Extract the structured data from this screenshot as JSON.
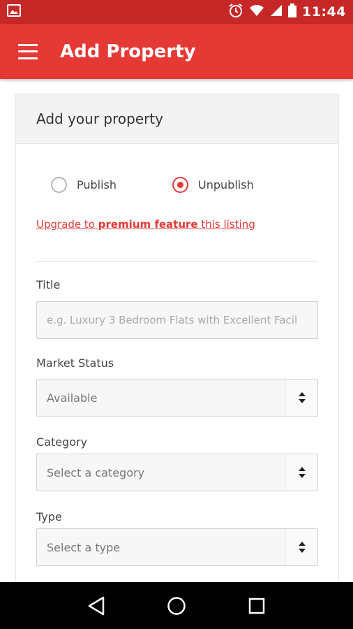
{
  "status_bar": {
    "time": "11:44",
    "icons": [
      "image-icon",
      "alarm-icon",
      "wifi-icon",
      "signal-icon",
      "battery-icon"
    ]
  },
  "app_bar": {
    "title": "Add Property",
    "menu_icon": "menu-icon"
  },
  "colors": {
    "status_bar": "#c62828",
    "app_bar": "#e53935",
    "accent": "#e53935"
  },
  "card": {
    "header": "Add your property",
    "publish_options": [
      {
        "label": "Publish",
        "selected": false
      },
      {
        "label": "Unpublish",
        "selected": true
      }
    ],
    "upgrade_link": {
      "prefix": "Upgrade to ",
      "bold": "premium feature",
      "suffix": " this listing"
    },
    "fields": {
      "title": {
        "label": "Title",
        "placeholder": "e.g. Luxury 3 Bedroom Flats with Excellent Facil"
      },
      "market_status": {
        "label": "Market Status",
        "value": "Available"
      },
      "category": {
        "label": "Category",
        "value": "Select a category"
      },
      "type": {
        "label": "Type",
        "value": "Select a type"
      }
    }
  },
  "nav_bar": {
    "icons": [
      "back-icon",
      "home-icon",
      "recents-icon"
    ]
  }
}
